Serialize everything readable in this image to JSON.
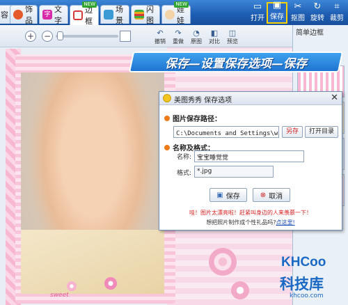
{
  "tabs": [
    {
      "label": "容",
      "color": "#2e7bd6"
    },
    {
      "label": "饰品",
      "color": "#e45a2a"
    },
    {
      "label": "文字",
      "color": "#d62aa8"
    },
    {
      "label": "边框",
      "color": "#d43a3a",
      "badge": "NEW"
    },
    {
      "label": "场景",
      "color": "#3a9bd4"
    },
    {
      "label": "闪图",
      "color": "#3fae3f"
    },
    {
      "label": "娃娃",
      "color": "#e8a91f",
      "badge": "NEW"
    }
  ],
  "tools": [
    {
      "label": "打开",
      "icon": "open-icon",
      "glyph": "▭"
    },
    {
      "label": "保存",
      "icon": "save-icon",
      "glyph": "💾"
    },
    {
      "label": "抠图",
      "icon": "scissors-icon",
      "glyph": "✂"
    },
    {
      "label": "旋转",
      "icon": "rotate-icon",
      "glyph": "↻"
    },
    {
      "label": "裁剪",
      "icon": "crop-icon",
      "glyph": "⌗"
    }
  ],
  "toolbar2": {
    "zoom_in": "+",
    "zoom_out": "−",
    "buttons": [
      "撤销",
      "重做",
      "原图",
      "对比",
      "预览"
    ]
  },
  "right_panel": {
    "caption": "简单边框"
  },
  "banner": {
    "text": "保存—设置保存选项—保存"
  },
  "dialog": {
    "title": "美图秀秀 保存选项",
    "close": "✕",
    "path_section": "图片保存路径：",
    "path_value": "C:\\Documents and Settings\\wj\\桌",
    "path_btn_save": "另存",
    "path_btn_open": "打开目录",
    "name_section": "名称及格式：",
    "name_label": "名称:",
    "name_value": "宝宝睡觉觉",
    "format_label": "格式:",
    "format_value": "*.jpg",
    "save_btn": "保存",
    "cancel_btn": "取消",
    "tip_red": "哇！图片太漂亮啦！赶紧叫身边的人来羡慕一下！",
    "tip_question": "想把照片制作成个性礼品吗?",
    "tip_link": "点这里!"
  },
  "photo": {
    "caption": "sweet"
  },
  "watermark": {
    "brand": "KHCoo",
    "cn": "科技库",
    "url": "khcoo.com"
  }
}
